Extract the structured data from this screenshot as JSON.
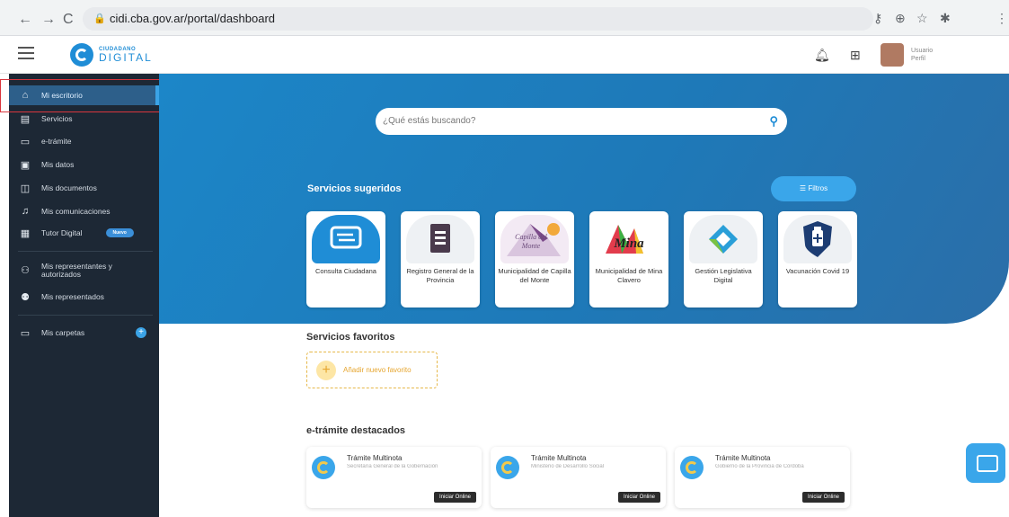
{
  "browser": {
    "url": "cidi.cba.gov.ar/portal/dashboard",
    "back_icon": "←",
    "forward_icon": "→",
    "reload_icon": "C"
  },
  "header": {
    "logo_small": "CIUDADANO",
    "logo_big": "DIGITAL",
    "user_name": "Usuario",
    "user_sub": "Perfil"
  },
  "sidebar": {
    "items": [
      {
        "label": "Mi escritorio",
        "icon": "home-icon"
      },
      {
        "label": "Servicios",
        "icon": "list-icon"
      },
      {
        "label": "e-trámite",
        "icon": "folder-icon"
      },
      {
        "label": "Mis datos",
        "icon": "id-card-icon"
      },
      {
        "label": "Mis documentos",
        "icon": "document-icon"
      },
      {
        "label": "Mis comunicaciones",
        "icon": "bell-icon"
      },
      {
        "label": "Tutor Digital",
        "icon": "tutor-icon",
        "badge": "Nuevo"
      },
      {
        "label": "Mis representantes y autorizados",
        "icon": "group-icon"
      },
      {
        "label": "Mis representados",
        "icon": "user-speak-icon"
      },
      {
        "label": "Mis carpetas",
        "icon": "folder-icon"
      }
    ]
  },
  "search": {
    "placeholder": "¿Qué estás buscando?"
  },
  "sugeridos": {
    "title": "Servicios sugeridos",
    "filter_label": "Filtros",
    "cards": [
      {
        "label": "Consulta Ciudadana",
        "icon": "chat-icon"
      },
      {
        "label": "Registro General de la Provincia",
        "icon": "book-icon"
      },
      {
        "label": "Municipalidad de Capilla del Monte",
        "icon": "capilla-logo"
      },
      {
        "label": "Municipalidad de Mina Clavero",
        "icon": "mina-logo"
      },
      {
        "label": "Gestión Legislativa Digital",
        "icon": "legislativa-logo"
      },
      {
        "label": "Vacunación Covid 19",
        "icon": "vaccine-icon"
      }
    ],
    "capilla_text": "Capilla del Monte",
    "mina_text": "Mina"
  },
  "favoritos": {
    "title": "Servicios favoritos",
    "add_label": "Añadir nuevo favorito"
  },
  "etramites": {
    "title": "e-trámite destacados",
    "items": [
      {
        "name": "Trámite Multinota",
        "org": "Secretaría General de la Gobernación",
        "action": "Iniciar Online"
      },
      {
        "name": "Trámite Multinota",
        "org": "Ministerio de Desarrollo Social",
        "action": "Iniciar Online"
      },
      {
        "name": "Trámite Multinota",
        "org": "Gobierno de la Provincia de Córdoba",
        "action": "Iniciar Online"
      }
    ]
  },
  "colors": {
    "brand": "#1f8dd6",
    "sidebar_bg": "#1d2835",
    "hero_bg": "#1c86c8",
    "highlight_box": "#d9363e"
  }
}
